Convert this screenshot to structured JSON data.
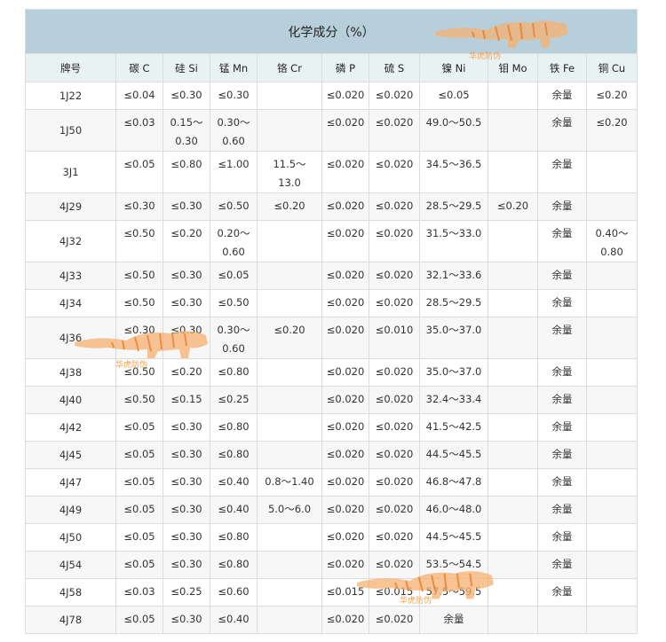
{
  "table": {
    "title": "化学成分（%）",
    "headers": [
      "牌号",
      "碳 C",
      "硅 Si",
      "锰 Mn",
      "铬 Cr",
      "磷 P",
      "硫 S",
      "镍 Ni",
      "钼 Mo",
      "铁 Fe",
      "铜 Cu"
    ],
    "rows": [
      [
        "1J22",
        "≤0.04",
        "≤0.30",
        "≤0.30",
        "",
        "≤0.020",
        "≤0.020",
        "≤0.05",
        "",
        "余量",
        "≤0.20"
      ],
      [
        "1J50",
        "≤0.03",
        "0.15～\n0.30",
        "0.30～\n0.60",
        "",
        "≤0.020",
        "≤0.020",
        "49.0～50.5",
        "",
        "余量",
        "≤0.20"
      ],
      [
        "3J1",
        "≤0.05",
        "≤0.80",
        "≤1.00",
        "11.5～\n13.0",
        "≤0.020",
        "≤0.020",
        "34.5～36.5",
        "",
        "余量",
        ""
      ],
      [
        "4J29",
        "≤0.30",
        "≤0.30",
        "≤0.50",
        "≤0.20",
        "≤0.020",
        "≤0.020",
        "28.5～29.5",
        "≤0.20",
        "余量",
        ""
      ],
      [
        "4J32",
        "≤0.50",
        "≤0.20",
        "0.20～\n0.60",
        "",
        "≤0.020",
        "≤0.020",
        "31.5～33.0",
        "",
        "余量",
        "0.40～\n0.80"
      ],
      [
        "4J33",
        "≤0.50",
        "≤0.30",
        "≤0.05",
        "",
        "≤0.020",
        "≤0.020",
        "32.1～33.6",
        "",
        "余量",
        ""
      ],
      [
        "4J34",
        "≤0.50",
        "≤0.30",
        "≤0.50",
        "",
        "≤0.020",
        "≤0.020",
        "28.5～29.5",
        "",
        "余量",
        ""
      ],
      [
        "4J36",
        "≤0.30",
        "≤0.30",
        "0.30～\n0.60",
        "≤0.20",
        "≤0.020",
        "≤0.010",
        "35.0～37.0",
        "",
        "余量",
        ""
      ],
      [
        "4J38",
        "≤0.50",
        "≤0.20",
        "≤0.80",
        "",
        "≤0.020",
        "≤0.020",
        "35.0～37.0",
        "",
        "余量",
        ""
      ],
      [
        "4J40",
        "≤0.50",
        "≤0.15",
        "≤0.25",
        "",
        "≤0.020",
        "≤0.020",
        "32.4～33.4",
        "",
        "余量",
        ""
      ],
      [
        "4J42",
        "≤0.05",
        "≤0.30",
        "≤0.80",
        "",
        "≤0.020",
        "≤0.020",
        "41.5～42.5",
        "",
        "余量",
        ""
      ],
      [
        "4J45",
        "≤0.05",
        "≤0.30",
        "≤0.80",
        "",
        "≤0.020",
        "≤0.020",
        "44.5～45.5",
        "",
        "余量",
        ""
      ],
      [
        "4J47",
        "≤0.05",
        "≤0.30",
        "≤0.40",
        "0.8～1.40",
        "≤0.020",
        "≤0.020",
        "46.8～47.8",
        "",
        "余量",
        ""
      ],
      [
        "4J49",
        "≤0.05",
        "≤0.30",
        "≤0.40",
        "5.0～6.0",
        "≤0.020",
        "≤0.020",
        "46.0～48.0",
        "",
        "余量",
        ""
      ],
      [
        "4J50",
        "≤0.05",
        "≤0.30",
        "≤0.80",
        "",
        "≤0.020",
        "≤0.020",
        "44.5～45.5",
        "",
        "余量",
        ""
      ],
      [
        "4J54",
        "≤0.05",
        "≤0.30",
        "≤0.80",
        "",
        "≤0.020",
        "≤0.020",
        "53.5～54.5",
        "",
        "余量",
        ""
      ],
      [
        "4J58",
        "≤0.03",
        "≤0.25",
        "≤0.60",
        "",
        "≤0.015",
        "≤0.015",
        "57.5～59.5",
        "",
        "余量",
        ""
      ],
      [
        "4J78",
        "≤0.05",
        "≤0.30",
        "≤0.40",
        "",
        "≤0.020",
        "≤0.020",
        "余量",
        "",
        "",
        ""
      ]
    ]
  },
  "watermark": {
    "text": "华虎防伪",
    "color": "#f2a155"
  }
}
